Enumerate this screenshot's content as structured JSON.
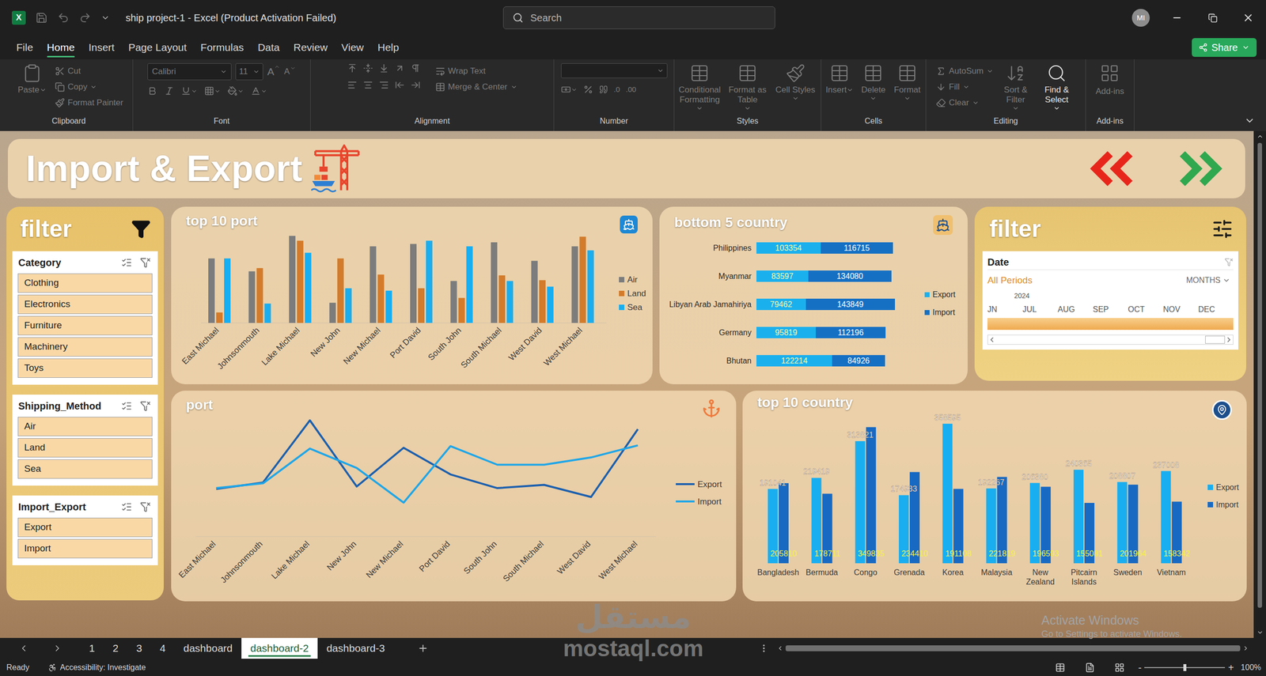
{
  "window": {
    "logo": "X",
    "title": "ship project-1 - Excel (Product Activation Failed)"
  },
  "search": {
    "placeholder": "Search"
  },
  "account": {
    "initials": "MI"
  },
  "menu": [
    {
      "label": "File",
      "selected": false
    },
    {
      "label": "Home",
      "selected": true
    },
    {
      "label": "Insert",
      "selected": false
    },
    {
      "label": "Page Layout",
      "selected": false
    },
    {
      "label": "Formulas",
      "selected": false
    },
    {
      "label": "Data",
      "selected": false
    },
    {
      "label": "Review",
      "selected": false
    },
    {
      "label": "View",
      "selected": false
    },
    {
      "label": "Help",
      "selected": false
    }
  ],
  "share": {
    "label": "Share"
  },
  "ribbon": {
    "clipboard": {
      "label": "Clipboard",
      "paste": {
        "label": "Paste",
        "disabled": true
      },
      "cut": {
        "label": "Cut",
        "disabled": true
      },
      "copy": {
        "label": "Copy",
        "disabled": true
      },
      "format_painter": {
        "label": "Format Painter",
        "disabled": true
      }
    },
    "font": {
      "label": "Font",
      "name": "Calibri",
      "size": "11",
      "grow": "A",
      "shrink": "A",
      "disabled": true
    },
    "alignment": {
      "label": "Alignment",
      "wrap_text": {
        "label": "Wrap Text",
        "disabled": true
      },
      "merge_center": {
        "label": "Merge & Center",
        "disabled": true
      }
    },
    "number": {
      "label": "Number",
      "increase_decimal": ".0",
      "decrease_decimal": ".00",
      "disabled": true
    },
    "styles": {
      "label": "Styles",
      "buttons": [
        {
          "label": "Conditional Formatting",
          "disabled": true
        },
        {
          "label": "Format as Table",
          "disabled": true
        },
        {
          "label": "Cell Styles",
          "disabled": true
        }
      ]
    },
    "cells": {
      "label": "Cells",
      "buttons": [
        {
          "label": "Insert",
          "disabled": true
        },
        {
          "label": "Delete",
          "disabled": true
        },
        {
          "label": "Format",
          "disabled": true
        }
      ]
    },
    "editing": {
      "label": "Editing",
      "autosum": {
        "label": "AutoSum",
        "disabled": true
      },
      "fill": {
        "label": "Fill",
        "disabled": true
      },
      "clear": {
        "label": "Clear",
        "disabled": true
      },
      "sort_filter": {
        "label": "Sort & Filter",
        "disabled": true
      },
      "find_select": {
        "label": "Find & Select",
        "disabled": false
      }
    },
    "addins": {
      "label": "Add-ins",
      "buttons": [
        {
          "label": "Add-ins",
          "disabled": true
        }
      ]
    }
  },
  "dashboard": {
    "title": "Import & Export",
    "nav": [
      {
        "direction": "back",
        "color": "#e8251b"
      },
      {
        "direction": "forward",
        "color": "#2fa84f"
      }
    ],
    "left_filter": {
      "title": "filter",
      "slicers": [
        {
          "title": "Category",
          "items": [
            {
              "label": "Clothing",
              "selected": true
            },
            {
              "label": "Electronics",
              "selected": true
            },
            {
              "label": "Furniture",
              "selected": true
            },
            {
              "label": "Machinery",
              "selected": true
            },
            {
              "label": "Toys",
              "selected": true
            }
          ]
        },
        {
          "title": "Shipping_Method",
          "items": [
            {
              "label": "Air",
              "selected": true
            },
            {
              "label": "Land",
              "selected": true
            },
            {
              "label": "Sea",
              "selected": true
            }
          ]
        },
        {
          "title": "Import_Export",
          "items": [
            {
              "label": "Export",
              "selected": true
            },
            {
              "label": "Import",
              "selected": true
            }
          ]
        }
      ]
    },
    "top_ports": {
      "title": "top 10 port",
      "categories": [
        "East Michael",
        "Johnsonmouth",
        "Lake Michael",
        "New John",
        "New Michael",
        "Port David",
        "South John",
        "South Michael",
        "West David",
        "West Michael"
      ],
      "series": [
        {
          "name": "Air",
          "color": "#7c7c7c",
          "values": [
            80,
            64,
            108,
            25,
            95,
            98,
            52,
            100,
            77,
            95
          ]
        },
        {
          "name": "Land",
          "color": "#d37b2a",
          "values": [
            13,
            68,
            102,
            80,
            60,
            43,
            31,
            59,
            53,
            107
          ]
        },
        {
          "name": "Sea",
          "color": "#19aef0",
          "values": [
            80,
            24,
            87,
            43,
            40,
            102,
            95,
            52,
            45,
            90
          ]
        }
      ]
    },
    "bottom_countries": {
      "title": "bottom 5 country",
      "categories": [
        "Philippines",
        "Myanmar",
        "Libyan Arab Jamahiriya",
        "Germany",
        "Bhutan"
      ],
      "series": [
        {
          "name": "Export",
          "color": "#1ab0ee",
          "label_color": "#fff9a6",
          "values": [
            103354,
            83597,
            79462,
            95819,
            122214
          ],
          "labels": [
            "103354",
            "83597",
            "79462",
            "95819",
            "122214"
          ]
        },
        {
          "name": "Import",
          "color": "#1570c4",
          "label_color": "#ffffff",
          "values": [
            116715,
            134080,
            143849,
            112196,
            84926
          ],
          "labels": [
            "116715",
            "134080",
            "143849",
            "112196",
            "84926"
          ]
        }
      ]
    },
    "right_filter": {
      "title": "filter",
      "timeline": {
        "title": "Date",
        "period": "All Periods",
        "unit": "MONTHS",
        "year": "2024",
        "months": [
          "JN",
          "JUL",
          "AUG",
          "SEP",
          "OCT",
          "NOV",
          "DEC"
        ],
        "level": 1
      }
    },
    "port_trend": {
      "title": "port",
      "categories": [
        "East Michael",
        "Johnsonmouth",
        "Lake Michael",
        "New John",
        "New Michael",
        "Port David",
        "South John",
        "South Michael",
        "West David",
        "West Michael"
      ],
      "series": [
        {
          "name": "Export",
          "color": "#1b5fae",
          "values": [
            59,
            67,
            144,
            62,
            110,
            77,
            60,
            64,
            49,
            133
          ]
        },
        {
          "name": "Import",
          "color": "#1fa6e8",
          "values": [
            60,
            66,
            109,
            85,
            42,
            112,
            89,
            89,
            98,
            113
          ]
        }
      ]
    },
    "top_countries": {
      "title": "top 10 country",
      "categories": [
        "Bangladesh",
        "Bermuda",
        "Congo",
        "Grenada",
        "Korea",
        "Malaysia",
        "New Zealand",
        "Pitcairn Islands",
        "Sweden",
        "Vietnam"
      ],
      "series": [
        {
          "name": "Export",
          "color": "#19aef0",
          "label_color": "#ffffff",
          "values": [
            191041,
            219419,
            313821,
            174933,
            358595,
            192267,
            206380,
            240365,
            208807,
            237008
          ],
          "labels": [
            "191041",
            "219419",
            "313821",
            "174933",
            "358595",
            "192267",
            "206380",
            "240365",
            "208807",
            "237008"
          ]
        },
        {
          "name": "Import",
          "color": "#1769c2",
          "label_color": "#f7f24a",
          "values": [
            205810,
            178711,
            349835,
            234410,
            191108,
            221819,
            196593,
            155081,
            201964,
            158342
          ],
          "labels": [
            "205810",
            "178711",
            "349835",
            "234410",
            "191108",
            "221819",
            "196593",
            "155081",
            "201964",
            "158342"
          ]
        }
      ]
    }
  },
  "sheet_tabs": [
    {
      "label": "1",
      "selected": false
    },
    {
      "label": "2",
      "selected": false
    },
    {
      "label": "3",
      "selected": false
    },
    {
      "label": "4",
      "selected": false
    },
    {
      "label": "dashboard",
      "selected": false
    },
    {
      "label": "dashboard-2",
      "selected": true
    },
    {
      "label": "dashboard-3",
      "selected": false
    }
  ],
  "status_bar": {
    "ready": "Ready",
    "accessibility": "Accessibility: Investigate",
    "zoom_out": "-",
    "zoom_in": "+",
    "zoom": "100%",
    "zoom_level": 0.5
  },
  "watermarks": {
    "site_ar": "مستقل",
    "site": "mostaql.com",
    "activation_title": "Activate Windows",
    "activation_hint": "Go to Settings to activate Windows."
  }
}
